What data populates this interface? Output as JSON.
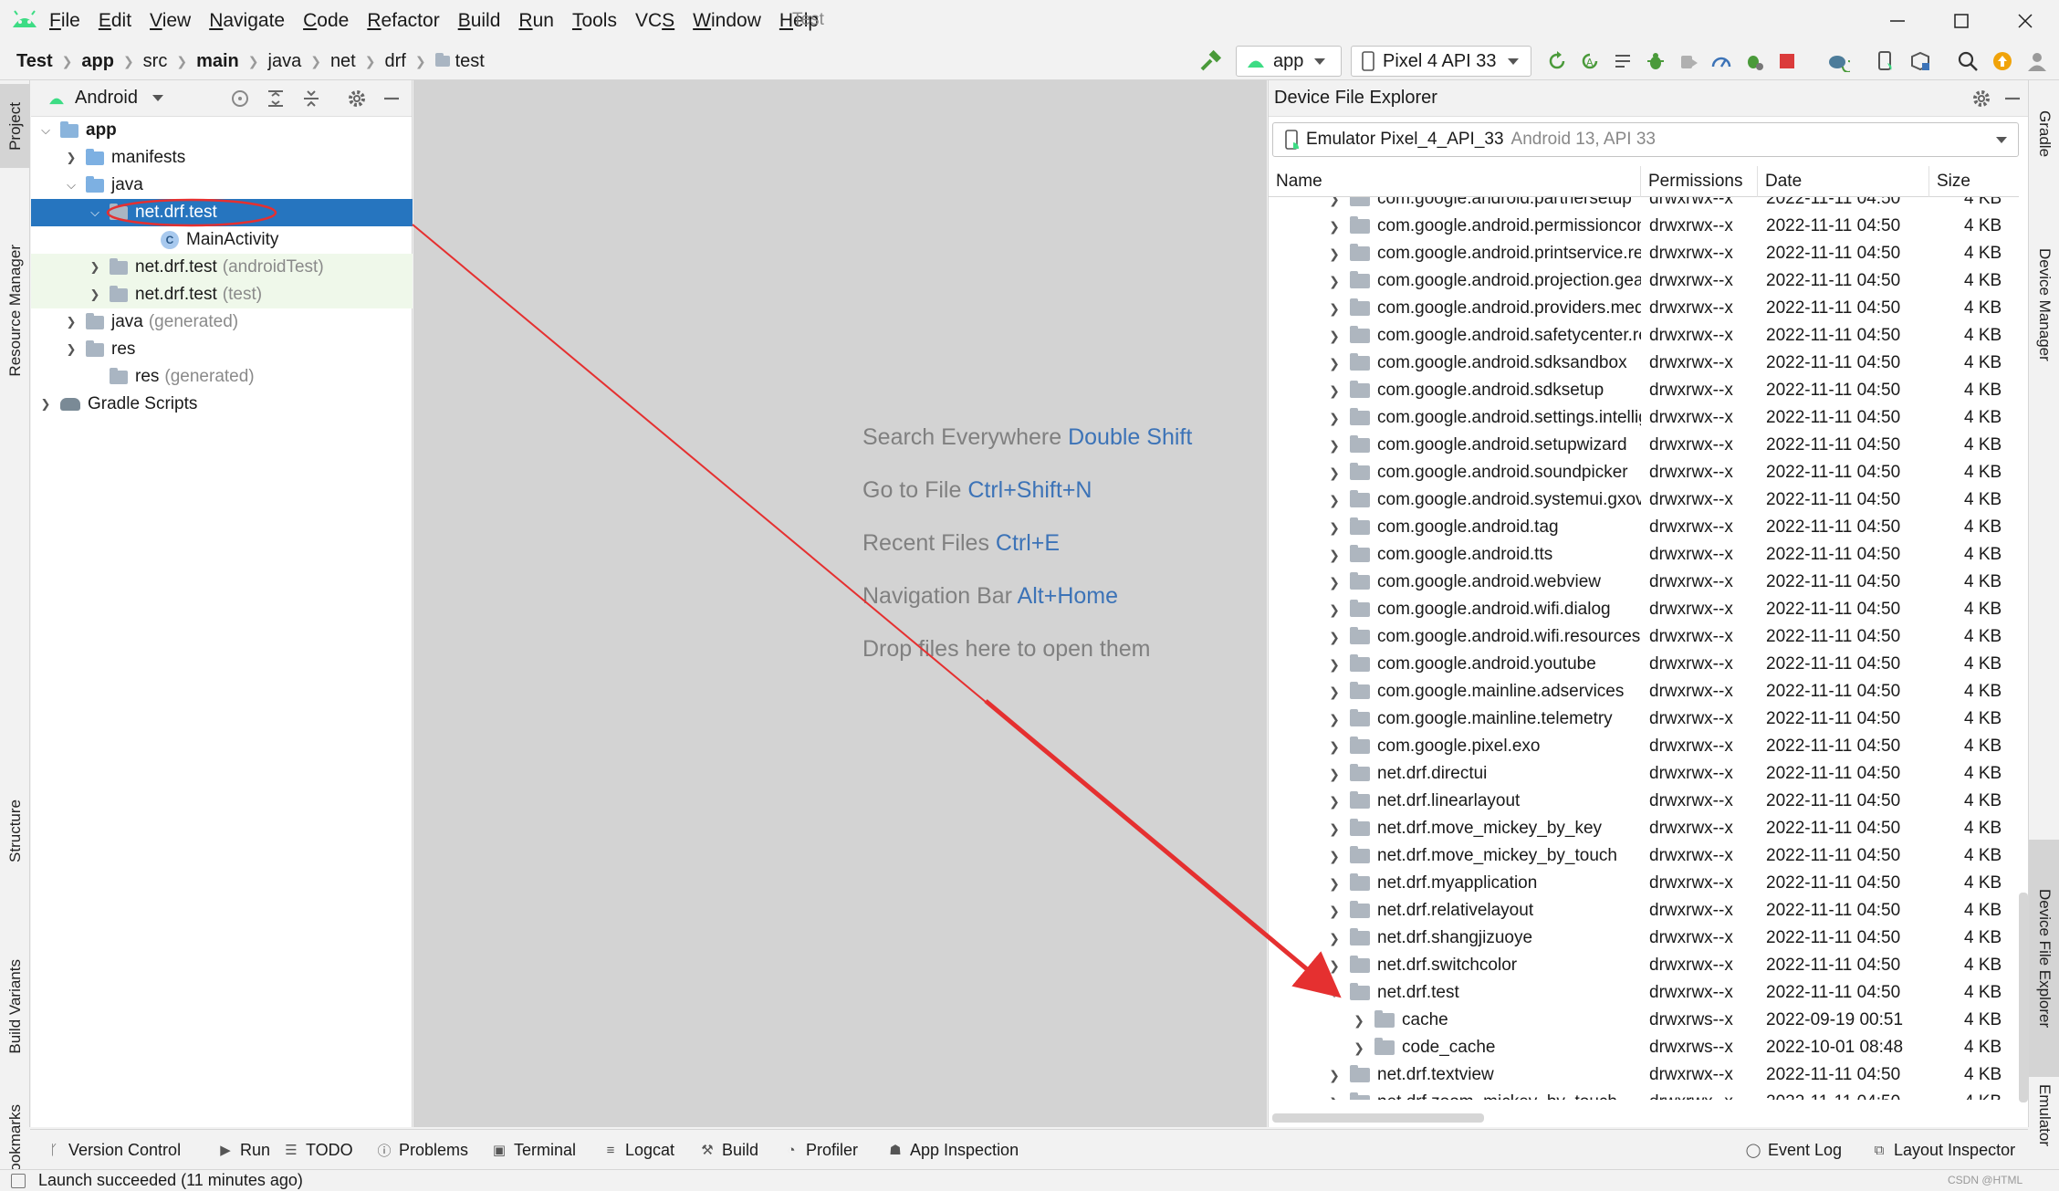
{
  "window": {
    "title": "Test",
    "menu": [
      "File",
      "Edit",
      "View",
      "Navigate",
      "Code",
      "Refactor",
      "Build",
      "Run",
      "Tools",
      "VCS",
      "Window",
      "Help"
    ],
    "mnemonics": [
      "F",
      "E",
      "V",
      "N",
      "C",
      "R",
      "B",
      "R",
      "T",
      "S",
      "W",
      "H"
    ]
  },
  "breadcrumbs": [
    "Test",
    "app",
    "src",
    "main",
    "java",
    "net",
    "drf",
    "test"
  ],
  "toolbar": {
    "run_config": "app",
    "device": "Pixel 4 API 33"
  },
  "colors": {
    "accent": "#2675bf",
    "link": "#3c73b7",
    "android_green": "#3ddc84",
    "stop_red": "#db3b3b",
    "annotation_red": "#e53030"
  },
  "left_tabs": [
    "Project",
    "Resource Manager",
    "Structure",
    "Build Variants",
    "Bookmarks"
  ],
  "right_tabs": [
    "Gradle",
    "Device Manager",
    "Device File Explorer",
    "Emulator"
  ],
  "project_panel": {
    "view_mode": "Android",
    "tree": [
      {
        "label": "app",
        "muted": "",
        "bold": true
      },
      {
        "label": "manifests",
        "muted": ""
      },
      {
        "label": "java",
        "muted": ""
      },
      {
        "label": "net.drf.test",
        "muted": ""
      },
      {
        "label": "MainActivity",
        "muted": ""
      },
      {
        "label": "net.drf.test",
        "muted": "(androidTest)"
      },
      {
        "label": "net.drf.test",
        "muted": "(test)"
      },
      {
        "label": "java",
        "muted": "(generated)"
      },
      {
        "label": "res",
        "muted": ""
      },
      {
        "label": "res",
        "muted": "(generated)"
      },
      {
        "label": "Gradle Scripts",
        "muted": ""
      }
    ]
  },
  "editor_hints": [
    {
      "text": "Search Everywhere",
      "key": "Double Shift"
    },
    {
      "text": "Go to File",
      "key": "Ctrl+Shift+N"
    },
    {
      "text": "Recent Files",
      "key": "Ctrl+E"
    },
    {
      "text": "Navigation Bar",
      "key": "Alt+Home"
    },
    {
      "text": "Drop files here to open them",
      "key": ""
    }
  ],
  "device_file_explorer": {
    "title": "Device File Explorer",
    "device_name": "Emulator Pixel_4_API_33",
    "device_info": "Android 13, API 33",
    "columns": [
      "Name",
      "Permissions",
      "Date",
      "Size"
    ],
    "rows": [
      {
        "name": "com.google.android.partnersetup",
        "perm": "drwxrwx--x",
        "date": "2022-11-11 04:50",
        "size": "4 KB",
        "depth": 0
      },
      {
        "name": "com.google.android.permissioncontroller",
        "perm": "drwxrwx--x",
        "date": "2022-11-11 04:50",
        "size": "4 KB",
        "depth": 0
      },
      {
        "name": "com.google.android.printservice.recommendation",
        "perm": "drwxrwx--x",
        "date": "2022-11-11 04:50",
        "size": "4 KB",
        "depth": 0
      },
      {
        "name": "com.google.android.projection.gearhead",
        "perm": "drwxrwx--x",
        "date": "2022-11-11 04:50",
        "size": "4 KB",
        "depth": 0
      },
      {
        "name": "com.google.android.providers.media.module",
        "perm": "drwxrwx--x",
        "date": "2022-11-11 04:50",
        "size": "4 KB",
        "depth": 0
      },
      {
        "name": "com.google.android.safetycenter.resources",
        "perm": "drwxrwx--x",
        "date": "2022-11-11 04:50",
        "size": "4 KB",
        "depth": 0
      },
      {
        "name": "com.google.android.sdksandbox",
        "perm": "drwxrwx--x",
        "date": "2022-11-11 04:50",
        "size": "4 KB",
        "depth": 0
      },
      {
        "name": "com.google.android.sdksetup",
        "perm": "drwxrwx--x",
        "date": "2022-11-11 04:50",
        "size": "4 KB",
        "depth": 0
      },
      {
        "name": "com.google.android.settings.intelligence",
        "perm": "drwxrwx--x",
        "date": "2022-11-11 04:50",
        "size": "4 KB",
        "depth": 0
      },
      {
        "name": "com.google.android.setupwizard",
        "perm": "drwxrwx--x",
        "date": "2022-11-11 04:50",
        "size": "4 KB",
        "depth": 0
      },
      {
        "name": "com.google.android.soundpicker",
        "perm": "drwxrwx--x",
        "date": "2022-11-11 04:50",
        "size": "4 KB",
        "depth": 0
      },
      {
        "name": "com.google.android.systemui.gxoverlay",
        "perm": "drwxrwx--x",
        "date": "2022-11-11 04:50",
        "size": "4 KB",
        "depth": 0
      },
      {
        "name": "com.google.android.tag",
        "perm": "drwxrwx--x",
        "date": "2022-11-11 04:50",
        "size": "4 KB",
        "depth": 0
      },
      {
        "name": "com.google.android.tts",
        "perm": "drwxrwx--x",
        "date": "2022-11-11 04:50",
        "size": "4 KB",
        "depth": 0
      },
      {
        "name": "com.google.android.webview",
        "perm": "drwxrwx--x",
        "date": "2022-11-11 04:50",
        "size": "4 KB",
        "depth": 0
      },
      {
        "name": "com.google.android.wifi.dialog",
        "perm": "drwxrwx--x",
        "date": "2022-11-11 04:50",
        "size": "4 KB",
        "depth": 0
      },
      {
        "name": "com.google.android.wifi.resources",
        "perm": "drwxrwx--x",
        "date": "2022-11-11 04:50",
        "size": "4 KB",
        "depth": 0
      },
      {
        "name": "com.google.android.youtube",
        "perm": "drwxrwx--x",
        "date": "2022-11-11 04:50",
        "size": "4 KB",
        "depth": 0
      },
      {
        "name": "com.google.mainline.adservices",
        "perm": "drwxrwx--x",
        "date": "2022-11-11 04:50",
        "size": "4 KB",
        "depth": 0
      },
      {
        "name": "com.google.mainline.telemetry",
        "perm": "drwxrwx--x",
        "date": "2022-11-11 04:50",
        "size": "4 KB",
        "depth": 0
      },
      {
        "name": "com.google.pixel.exo",
        "perm": "drwxrwx--x",
        "date": "2022-11-11 04:50",
        "size": "4 KB",
        "depth": 0
      },
      {
        "name": "net.drf.directui",
        "perm": "drwxrwx--x",
        "date": "2022-11-11 04:50",
        "size": "4 KB",
        "depth": 0
      },
      {
        "name": "net.drf.linearlayout",
        "perm": "drwxrwx--x",
        "date": "2022-11-11 04:50",
        "size": "4 KB",
        "depth": 0
      },
      {
        "name": "net.drf.move_mickey_by_key",
        "perm": "drwxrwx--x",
        "date": "2022-11-11 04:50",
        "size": "4 KB",
        "depth": 0
      },
      {
        "name": "net.drf.move_mickey_by_touch",
        "perm": "drwxrwx--x",
        "date": "2022-11-11 04:50",
        "size": "4 KB",
        "depth": 0
      },
      {
        "name": "net.drf.myapplication",
        "perm": "drwxrwx--x",
        "date": "2022-11-11 04:50",
        "size": "4 KB",
        "depth": 0
      },
      {
        "name": "net.drf.relativelayout",
        "perm": "drwxrwx--x",
        "date": "2022-11-11 04:50",
        "size": "4 KB",
        "depth": 0
      },
      {
        "name": "net.drf.shangjizuoye",
        "perm": "drwxrwx--x",
        "date": "2022-11-11 04:50",
        "size": "4 KB",
        "depth": 0
      },
      {
        "name": "net.drf.switchcolor",
        "perm": "drwxrwx--x",
        "date": "2022-11-11 04:50",
        "size": "4 KB",
        "depth": 0
      },
      {
        "name": "net.drf.test",
        "perm": "drwxrwx--x",
        "date": "2022-11-11 04:50",
        "size": "4 KB",
        "depth": 0,
        "expanded": true
      },
      {
        "name": "cache",
        "perm": "drwxrws--x",
        "date": "2022-09-19 00:51",
        "size": "4 KB",
        "depth": 1
      },
      {
        "name": "code_cache",
        "perm": "drwxrws--x",
        "date": "2022-10-01 08:48",
        "size": "4 KB",
        "depth": 1
      },
      {
        "name": "net.drf.textview",
        "perm": "drwxrwx--x",
        "date": "2022-11-11 04:50",
        "size": "4 KB",
        "depth": 0
      },
      {
        "name": "net.drf.zoom_mickey_by_touch",
        "perm": "drwxrwx--x",
        "date": "2022-11-11 04:50",
        "size": "4 KB",
        "depth": 0
      }
    ]
  },
  "bottom_tabs": [
    "Version Control",
    "Run",
    "TODO",
    "Problems",
    "Terminal",
    "Logcat",
    "Build",
    "Profiler",
    "App Inspection"
  ],
  "bottom_right_tabs": [
    "Event Log",
    "Layout Inspector"
  ],
  "status": {
    "message": "Launch succeeded (11 minutes ago)",
    "watermark": "CSDN @HTML"
  }
}
